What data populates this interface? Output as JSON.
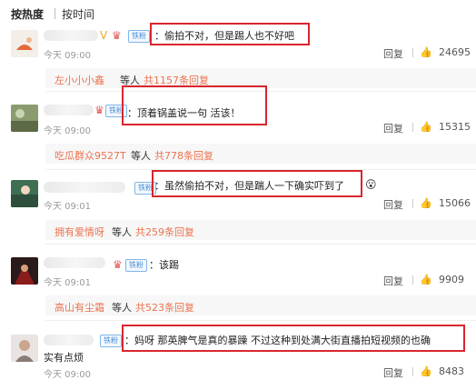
{
  "tabs": {
    "hot": "按热度",
    "time": "按时间"
  },
  "common": {
    "fans_badge": "铁粉",
    "reply": "回复",
    "like_icon": "thumbs-up-icon",
    "reply_by": "等人",
    "sub_prefix": "共",
    "sub_suffix": "条回复"
  },
  "colors": {
    "highlight": "#d9262e",
    "username": "#eb7350",
    "badge": "#4a8fd3"
  },
  "comments": [
    {
      "text": "：偷拍不对，但是踢人也不好吧",
      "time": "今天 09:00",
      "likes": "24695",
      "sub": {
        "user": "左小小小鑫",
        "count": "1157"
      }
    },
    {
      "text": "：顶着锅盖说一句 活该！",
      "time": "今天 09:00",
      "likes": "15315",
      "sub": {
        "user": "吃瓜群众9527T",
        "count": "778"
      }
    },
    {
      "text": "：虽然偷拍不对，但是踹人一下确实吓到了",
      "time": "今天 09:01",
      "likes": "15066",
      "sub": {
        "user": "拥有爱情呀",
        "count": "259"
      }
    },
    {
      "text": "：该踢",
      "time": "今天 09:01",
      "likes": "9909",
      "sub": {
        "user": "高山有尘霜",
        "count": "523"
      }
    },
    {
      "text": "：妈呀 那英脾气是真的暴躁 不过这种到处满大街直播拍短视频的也确",
      "text2": "实有点烦",
      "time": "今天 09:00",
      "likes": "8483"
    }
  ]
}
